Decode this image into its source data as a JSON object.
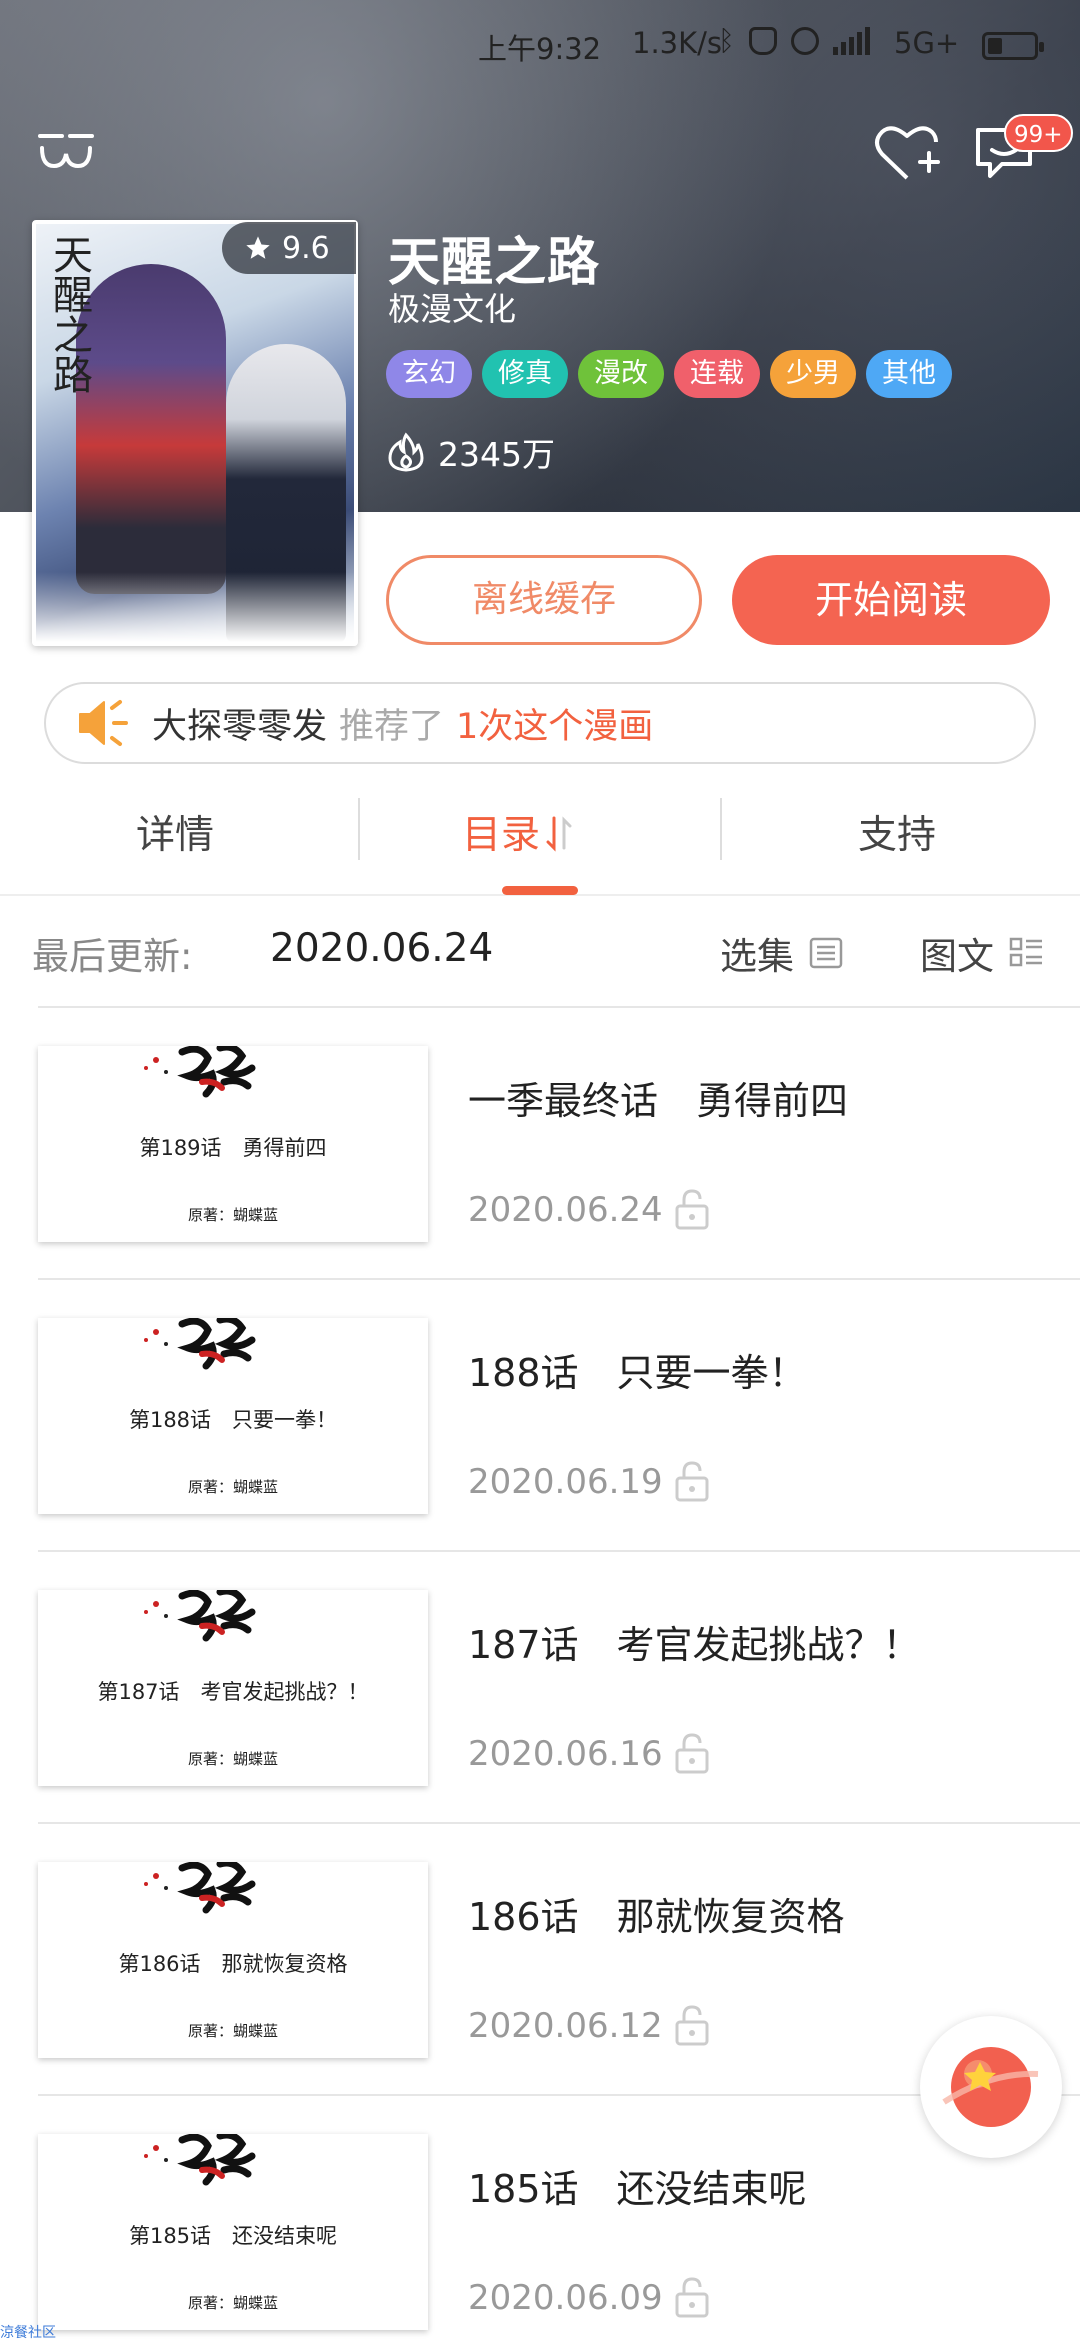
{
  "status_bar": {
    "time": "上午9:32",
    "speed": "1.3K/s",
    "network": "5G+",
    "icons": [
      "bluetooth-icon",
      "mute-icon",
      "alarm-icon",
      "signal-icon",
      "battery-icon"
    ]
  },
  "header": {
    "message_badge": "99+"
  },
  "comic": {
    "title": "天醒之路",
    "cover_title": "天醒之路",
    "author": "极漫文化",
    "rating": "9.6",
    "popularity": "2345万",
    "tags": [
      {
        "label": "玄幻",
        "color": "#8f87e8"
      },
      {
        "label": "修真",
        "color": "#21c2b0"
      },
      {
        "label": "漫改",
        "color": "#6fc23a"
      },
      {
        "label": "连载",
        "color": "#f0606b"
      },
      {
        "label": "少男",
        "color": "#f5a23a"
      },
      {
        "label": "其他",
        "color": "#4ea8f5"
      }
    ]
  },
  "actions": {
    "cache_label": "离线缓存",
    "read_label": "开始阅读"
  },
  "recommend": {
    "user": "大探零零发",
    "middle": "推荐了",
    "count_text": "1次这个漫画"
  },
  "tabs": {
    "details": "详情",
    "catalog": "目录",
    "support": "支持"
  },
  "catalog": {
    "last_update_label": "最后更新:",
    "last_update_date": "2020.06.24",
    "select_label": "选集",
    "mode_label": "图文"
  },
  "chapters": [
    {
      "title": "一季最终话　勇得前四",
      "date": "2020.06.24",
      "thumb_caption": "第189话　勇得前四",
      "thumb_author": "原著：蝴蝶蓝"
    },
    {
      "title": "188话　只要一拳！",
      "date": "2020.06.19",
      "thumb_caption": "第188话　只要一拳！",
      "thumb_author": "原著：蝴蝶蓝"
    },
    {
      "title": "187话　考官发起挑战？！",
      "date": "2020.06.16",
      "thumb_caption": "第187话　考官发起挑战？！",
      "thumb_author": "原著：蝴蝶蓝"
    },
    {
      "title": "186话　那就恢复资格",
      "date": "2020.06.12",
      "thumb_caption": "第186话　那就恢复资格",
      "thumb_author": "原著：蝴蝶蓝"
    },
    {
      "title": "185话　还没结束呢",
      "date": "2020.06.09",
      "thumb_caption": "第185话　还没结束呢",
      "thumb_author": "原著：蝴蝶蓝"
    }
  ],
  "watermark": "涼餐社区",
  "colors": {
    "accent": "#f2613f",
    "read_button": "#f46451",
    "cache_border": "#f08a67"
  }
}
